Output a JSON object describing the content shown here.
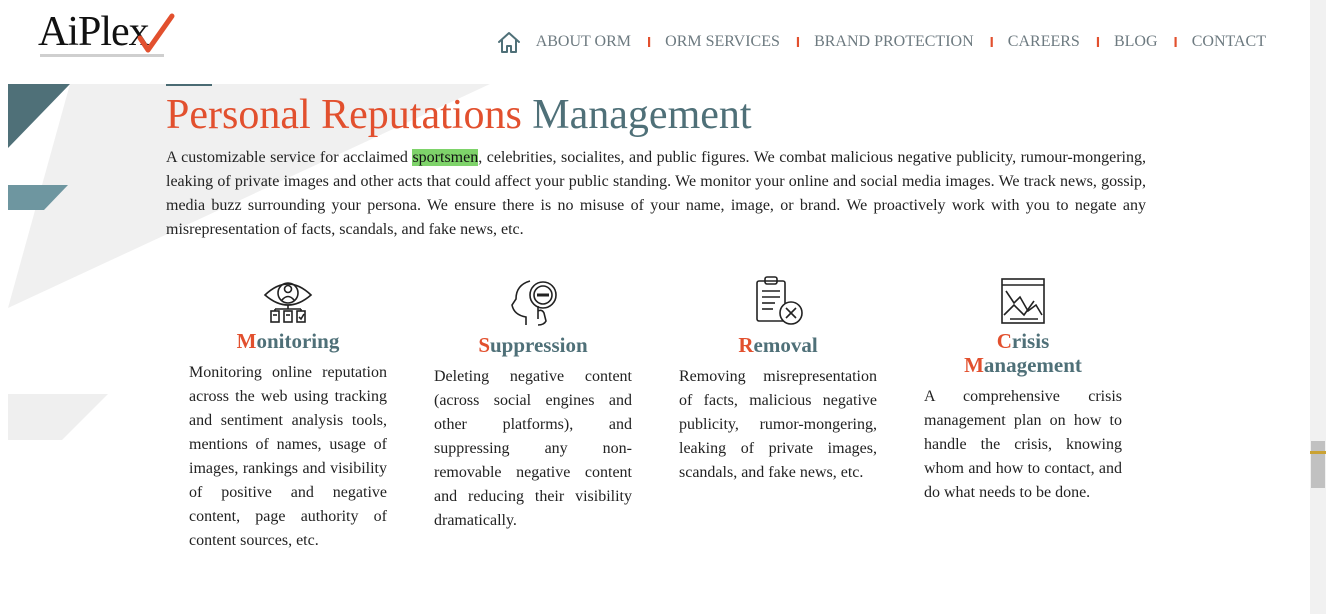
{
  "brand": {
    "logo_text": "AiPlex"
  },
  "nav": {
    "home_icon": "home-icon",
    "items": [
      {
        "label": "ABOUT ORM"
      },
      {
        "label": "ORM SERVICES"
      },
      {
        "label": "BRAND PROTECTION"
      },
      {
        "label": "CAREERS"
      },
      {
        "label": "BLOG"
      },
      {
        "label": "CONTACT"
      }
    ],
    "separator": "I"
  },
  "main": {
    "title_accent": "Personal Reputations",
    "title_rest": "Management",
    "intro_before": "A customizable service for acclaimed ",
    "intro_highlight": "sportsmen",
    "intro_after": ", celebrities, socialites, and public figures. We combat malicious negative publicity, rumour-mongering, leaking of private images and other acts that could affect your public standing. We monitor your online and social media images. We track news, gossip, media buzz surrounding your persona. We ensure there is no misuse of your name, image, or brand. We proactively work with you to negate any misrepresentation of facts, scandals, and fake news, etc."
  },
  "services": [
    {
      "icon": "monitoring-eye-icon",
      "title_first": "M",
      "title_rest": "onitoring",
      "description": "Monitoring online reputation across the web using tracking and sentiment analysis tools, mentions of names, usage of images, rankings and visibility of positive and negative content, page authority of content sources, etc."
    },
    {
      "icon": "suppression-head-icon",
      "title_first": "S",
      "title_rest": "uppression",
      "description": "Deleting negative content (across social engines and other platforms), and suppressing any non-removable negative content and reducing their visibility dramatically."
    },
    {
      "icon": "removal-clipboard-icon",
      "title_first": "R",
      "title_rest": "emoval",
      "description": "Removing misrepresentation of facts, malicious negative publicity, rumor-mongering, leaking of private images, scandals, and fake news, etc."
    },
    {
      "icon": "crisis-chart-icon",
      "title_first": "C",
      "title_rest": "risis",
      "title_line2_first": "M",
      "title_line2_rest": "anagement",
      "description": "A comprehensive crisis management plan on how to handle the crisis, knowing whom and how to contact, and do what needs to be done."
    }
  ],
  "colors": {
    "accent": "#e2502e",
    "teal": "#4f7078",
    "highlight": "#7ed36a",
    "nav_text": "#6d7a80"
  }
}
